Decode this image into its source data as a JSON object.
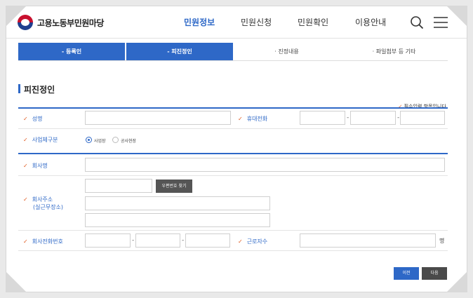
{
  "header": {
    "site_title": "고용노동부민원마당",
    "nav": [
      "민원정보",
      "민원신청",
      "민원확인",
      "이용안내"
    ]
  },
  "steps": [
    {
      "label": "- 등록인",
      "state": "on"
    },
    {
      "label": "- 피진정인",
      "state": "on"
    },
    {
      "label": "· 진정내용",
      "state": "off"
    },
    {
      "label": "· 파일첨부 등 기타",
      "state": "off"
    }
  ],
  "section": {
    "title": "피진정인",
    "required_note": "필수입력 항목입니다."
  },
  "form": {
    "name_label": "성명",
    "phone_label": "휴대전화",
    "business_type_label": "사업체구분",
    "business_type_options": [
      "사업장",
      "공사현장"
    ],
    "company_label": "회사명",
    "address_label_1": "회사주소",
    "address_label_2": "(실근무장소)",
    "postcode_button": "우편번호 찾기",
    "company_phone_label": "회사전화번호",
    "workers_label": "근로자수",
    "workers_unit": "명",
    "dash": "-"
  },
  "buttons": {
    "prev": "이전",
    "next": "다음"
  },
  "colors": {
    "accent": "#2e68c7",
    "required_mark": "#e05a1f"
  }
}
